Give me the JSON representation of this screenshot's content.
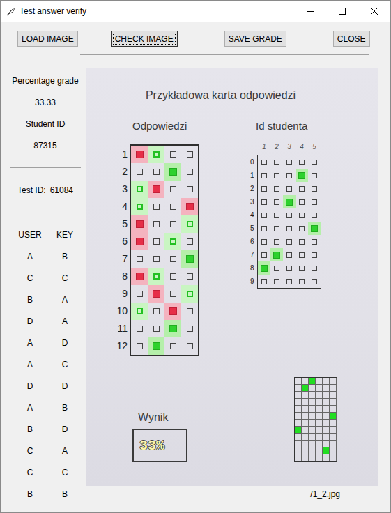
{
  "window": {
    "title": "Test answer verify"
  },
  "toolbar": {
    "buttons": [
      {
        "label": "LOAD IMAGE",
        "focused": false
      },
      {
        "label": "CHECK IMAGE",
        "focused": true
      },
      {
        "label": "SAVE GRADE",
        "focused": false
      },
      {
        "label": "CLOSE",
        "focused": false
      }
    ]
  },
  "summary": {
    "grade_label": "Percentage grade",
    "grade": "33.33",
    "student_label": "Student ID",
    "student_id": "87315",
    "test_label": "Test ID:",
    "test_id": "61084"
  },
  "results": {
    "columns": [
      "USER",
      "KEY"
    ],
    "rows": [
      {
        "user": "A",
        "key": "B"
      },
      {
        "user": "C",
        "key": "C"
      },
      {
        "user": "B",
        "key": "A"
      },
      {
        "user": "D",
        "key": "A"
      },
      {
        "user": "A",
        "key": "D"
      },
      {
        "user": "A",
        "key": "C"
      },
      {
        "user": "D",
        "key": "D"
      },
      {
        "user": "A",
        "key": "B"
      },
      {
        "user": "B",
        "key": "D"
      },
      {
        "user": "C",
        "key": "A"
      },
      {
        "user": "C",
        "key": "C"
      },
      {
        "user": "B",
        "key": "B"
      }
    ]
  },
  "sheet": {
    "title": "Przykładowa karta odpowiedzi",
    "answers_heading": "Odpowiedzi",
    "id_heading": "Id studenta",
    "questions": [
      {
        "number": "1",
        "cells": [
          {
            "marked": true,
            "key": false
          },
          {
            "marked": false,
            "key": true
          },
          {
            "marked": false,
            "key": false
          },
          {
            "marked": false,
            "key": false
          }
        ]
      },
      {
        "number": "2",
        "cells": [
          {
            "marked": false,
            "key": false
          },
          {
            "marked": false,
            "key": false
          },
          {
            "marked": true,
            "key": true
          },
          {
            "marked": false,
            "key": false
          }
        ]
      },
      {
        "number": "3",
        "cells": [
          {
            "marked": false,
            "key": true
          },
          {
            "marked": true,
            "key": false
          },
          {
            "marked": false,
            "key": false
          },
          {
            "marked": false,
            "key": false
          }
        ]
      },
      {
        "number": "4",
        "cells": [
          {
            "marked": false,
            "key": true
          },
          {
            "marked": false,
            "key": false
          },
          {
            "marked": false,
            "key": false
          },
          {
            "marked": true,
            "key": false
          }
        ]
      },
      {
        "number": "5",
        "cells": [
          {
            "marked": true,
            "key": false
          },
          {
            "marked": false,
            "key": false
          },
          {
            "marked": false,
            "key": false
          },
          {
            "marked": false,
            "key": true
          }
        ]
      },
      {
        "number": "6",
        "cells": [
          {
            "marked": true,
            "key": false
          },
          {
            "marked": false,
            "key": false
          },
          {
            "marked": false,
            "key": true
          },
          {
            "marked": false,
            "key": false
          }
        ]
      },
      {
        "number": "7",
        "cells": [
          {
            "marked": false,
            "key": false
          },
          {
            "marked": false,
            "key": false
          },
          {
            "marked": false,
            "key": false
          },
          {
            "marked": true,
            "key": true
          }
        ]
      },
      {
        "number": "8",
        "cells": [
          {
            "marked": true,
            "key": false
          },
          {
            "marked": false,
            "key": true
          },
          {
            "marked": false,
            "key": false
          },
          {
            "marked": false,
            "key": false
          }
        ]
      },
      {
        "number": "9",
        "cells": [
          {
            "marked": false,
            "key": false
          },
          {
            "marked": true,
            "key": false
          },
          {
            "marked": false,
            "key": false
          },
          {
            "marked": false,
            "key": true
          }
        ]
      },
      {
        "number": "10",
        "cells": [
          {
            "marked": false,
            "key": true
          },
          {
            "marked": false,
            "key": false
          },
          {
            "marked": true,
            "key": false
          },
          {
            "marked": false,
            "key": false
          }
        ]
      },
      {
        "number": "11",
        "cells": [
          {
            "marked": false,
            "key": false
          },
          {
            "marked": false,
            "key": false
          },
          {
            "marked": true,
            "key": true
          },
          {
            "marked": false,
            "key": false
          }
        ]
      },
      {
        "number": "12",
        "cells": [
          {
            "marked": false,
            "key": false
          },
          {
            "marked": true,
            "key": true
          },
          {
            "marked": false,
            "key": false
          },
          {
            "marked": false,
            "key": false
          }
        ]
      }
    ],
    "id_columns": [
      "1",
      "2",
      "3",
      "4",
      "5"
    ],
    "id_rows": [
      {
        "label": "0",
        "marked": [
          false,
          false,
          false,
          false,
          false
        ]
      },
      {
        "label": "1",
        "marked": [
          false,
          false,
          false,
          true,
          false
        ]
      },
      {
        "label": "2",
        "marked": [
          false,
          false,
          false,
          false,
          false
        ]
      },
      {
        "label": "3",
        "marked": [
          false,
          false,
          true,
          false,
          false
        ]
      },
      {
        "label": "4",
        "marked": [
          false,
          false,
          false,
          false,
          false
        ]
      },
      {
        "label": "5",
        "marked": [
          false,
          false,
          false,
          false,
          true
        ]
      },
      {
        "label": "6",
        "marked": [
          false,
          false,
          false,
          false,
          false
        ]
      },
      {
        "label": "7",
        "marked": [
          false,
          true,
          false,
          false,
          false
        ]
      },
      {
        "label": "8",
        "marked": [
          true,
          false,
          false,
          false,
          false
        ]
      },
      {
        "label": "9",
        "marked": [
          false,
          false,
          false,
          false,
          false
        ]
      }
    ],
    "score_label": "Wynik",
    "score": "33%",
    "test_grid": [
      [
        false,
        false,
        true,
        false,
        false,
        false
      ],
      [
        false,
        true,
        false,
        false,
        false,
        false
      ],
      [
        false,
        false,
        false,
        false,
        false,
        false
      ],
      [
        false,
        false,
        false,
        false,
        false,
        false
      ],
      [
        false,
        false,
        false,
        false,
        false,
        false
      ],
      [
        false,
        false,
        false,
        false,
        false,
        true
      ],
      [
        false,
        false,
        false,
        false,
        false,
        false
      ],
      [
        true,
        false,
        false,
        false,
        false,
        false
      ],
      [
        false,
        false,
        false,
        false,
        false,
        false
      ],
      [
        false,
        false,
        false,
        false,
        false,
        false
      ],
      [
        false,
        false,
        false,
        false,
        true,
        false
      ],
      [
        false,
        false,
        false,
        false,
        false,
        false
      ]
    ]
  },
  "file_name": "/1_2.jpg"
}
